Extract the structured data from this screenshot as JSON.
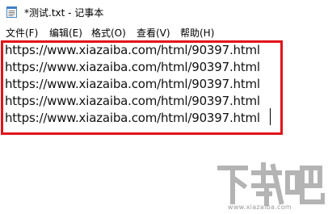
{
  "window": {
    "title": "*测试.txt - 记事本"
  },
  "menu": {
    "items": [
      {
        "label": "文件(F)"
      },
      {
        "label": "编辑(E)"
      },
      {
        "label": "格式(O)"
      },
      {
        "label": "查看(V)"
      },
      {
        "label": "帮助(H)"
      }
    ]
  },
  "editor": {
    "lines": [
      "https://www.xiazaiba.com/html/90397.html",
      "https://www.xiazaiba.com/html/90397.html",
      "https://www.xiazaiba.com/html/90397.html",
      "https://www.xiazaiba.com/html/90397.html",
      "https://www.xiazaiba.com/html/90397.html"
    ]
  },
  "watermark": {
    "logo_text": "下载吧",
    "sub_text": "www.xiazaiba.com"
  },
  "colors": {
    "highlight_border": "#e0141a",
    "text": "#111111",
    "watermark": "#9a9a9a"
  },
  "icons": {
    "app": "notepad-icon"
  }
}
